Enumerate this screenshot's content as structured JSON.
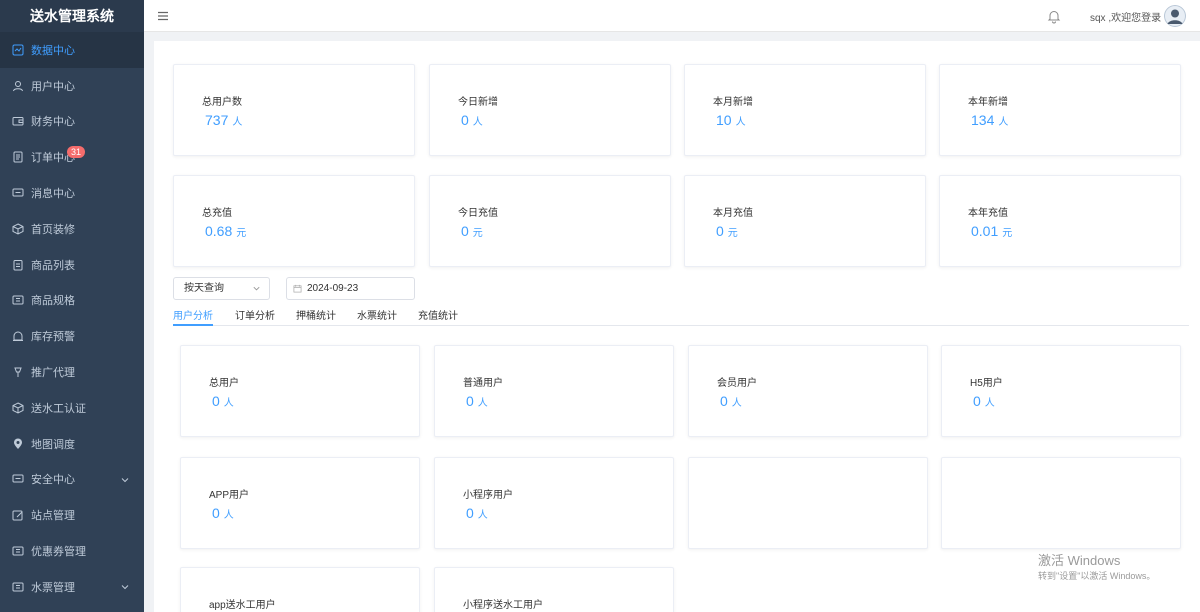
{
  "app_title": "送水管理系统",
  "sidebar": {
    "items": [
      {
        "label": "数据中心",
        "icon": "dashboard-icon"
      },
      {
        "label": "用户中心",
        "icon": "user-icon"
      },
      {
        "label": "财务中心",
        "icon": "wallet-icon"
      },
      {
        "label": "订单中心",
        "icon": "document-icon",
        "badge": "31"
      },
      {
        "label": "消息中心",
        "icon": "message-icon"
      },
      {
        "label": "首页装修",
        "icon": "box-icon"
      },
      {
        "label": "商品列表",
        "icon": "clipboard-icon"
      },
      {
        "label": "商品规格",
        "icon": "grid-icon"
      },
      {
        "label": "库存预警",
        "icon": "alarm-icon"
      },
      {
        "label": "推广代理",
        "icon": "pin-icon"
      },
      {
        "label": "送水工认证",
        "icon": "box-icon"
      },
      {
        "label": "地图调度",
        "icon": "location-icon"
      },
      {
        "label": "安全中心",
        "icon": "message-icon"
      },
      {
        "label": "站点管理",
        "icon": "edit-icon"
      },
      {
        "label": "优惠券管理",
        "icon": "grid-icon"
      },
      {
        "label": "水票管理",
        "icon": "grid-icon"
      }
    ]
  },
  "header": {
    "welcome": "sqx ,欢迎您登录"
  },
  "stats_row1": [
    {
      "title": "总用户数",
      "value": "737",
      "unit": "人"
    },
    {
      "title": "今日新增",
      "value": "0",
      "unit": "人"
    },
    {
      "title": "本月新增",
      "value": "10",
      "unit": "人"
    },
    {
      "title": "本年新增",
      "value": "134",
      "unit": "人"
    }
  ],
  "stats_row2": [
    {
      "title": "总充值",
      "value": "0.68",
      "unit": "元"
    },
    {
      "title": "今日充值",
      "value": "0",
      "unit": "元"
    },
    {
      "title": "本月充值",
      "value": "0",
      "unit": "元"
    },
    {
      "title": "本年充值",
      "value": "0.01",
      "unit": "元"
    }
  ],
  "filter": {
    "query_type": "按天查询",
    "date": "2024-09-23"
  },
  "tabs": [
    "用户分析",
    "订单分析",
    "押桶统计",
    "水票统计",
    "充值统计"
  ],
  "user_stats": [
    {
      "title": "总用户",
      "value": "0",
      "unit": "人"
    },
    {
      "title": "普通用户",
      "value": "0",
      "unit": "人"
    },
    {
      "title": "会员用户",
      "value": "0",
      "unit": "人"
    },
    {
      "title": "H5用户",
      "value": "0",
      "unit": "人"
    },
    {
      "title": "APP用户",
      "value": "0",
      "unit": "人"
    },
    {
      "title": "小程序用户",
      "value": "0",
      "unit": "人"
    },
    {
      "title": "app送水工用户",
      "value": "",
      "unit": ""
    },
    {
      "title": "小程序送水工用户",
      "value": "",
      "unit": ""
    }
  ],
  "watermark": {
    "line1": "激活 Windows",
    "line2": "转到\"设置\"以激活 Windows。"
  }
}
